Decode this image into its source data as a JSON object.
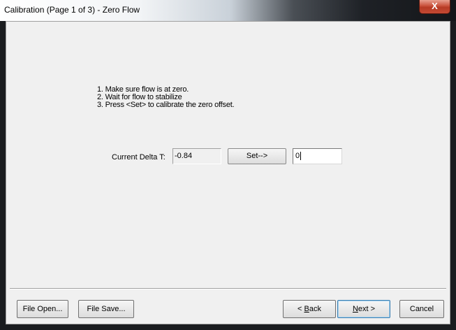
{
  "window": {
    "title": "Calibration (Page 1 of 3) - Zero Flow",
    "close_label": "X"
  },
  "instructions": [
    "1. Make sure flow is at zero.",
    "2. Wait for flow to stabilize",
    "3. Press <Set> to calibrate the zero offset."
  ],
  "delta": {
    "label": "Current Delta T:",
    "value": "-0.84",
    "set_label": "Set-->",
    "zero_value": "0"
  },
  "footer": {
    "file_open": "File Open...",
    "file_save": "File Save...",
    "back_prefix": "< ",
    "back_accel": "B",
    "back_rest": "ack",
    "next_accel": "N",
    "next_rest": "ext >",
    "cancel": "Cancel"
  }
}
